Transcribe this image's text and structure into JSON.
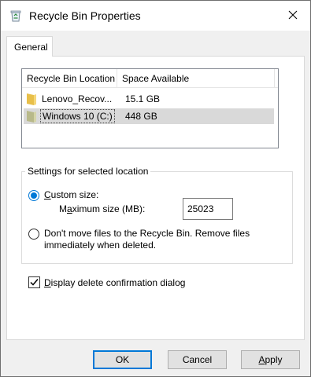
{
  "window": {
    "title": "Recycle Bin Properties",
    "accent": "#0078d7"
  },
  "tabs": [
    {
      "label": "General",
      "selected": true
    }
  ],
  "locations": {
    "columns": [
      "Recycle Bin Location",
      "Space Available"
    ],
    "rows": [
      {
        "name": "Lenovo_Recov...",
        "space": "15.1 GB",
        "selected": false
      },
      {
        "name": "Windows 10 (C:)",
        "space": "448 GB",
        "selected": true
      }
    ]
  },
  "settings": {
    "group_label": "Settings for selected location",
    "custom_size_label": "Custom size:",
    "custom_size_checked": true,
    "max_size_label": "Maximum size (MB):",
    "max_size_value": "25023",
    "dont_move_label": "Don't move files to the Recycle Bin. Remove files immediately when deleted.",
    "dont_move_line1": "Don't move files to the Recycle Bin. Remove files",
    "dont_move_line2": "immediately when deleted.",
    "dont_move_checked": false
  },
  "confirm": {
    "label": "Display delete confirmation dialog",
    "checked": true
  },
  "buttons": {
    "ok": "OK",
    "cancel": "Cancel",
    "apply": "Apply"
  },
  "icons": {
    "title": "recycle-bin-icon",
    "close": "close-icon",
    "folder": "folder-icon",
    "drive": "drive-folder-icon",
    "check": "checkmark-icon"
  }
}
